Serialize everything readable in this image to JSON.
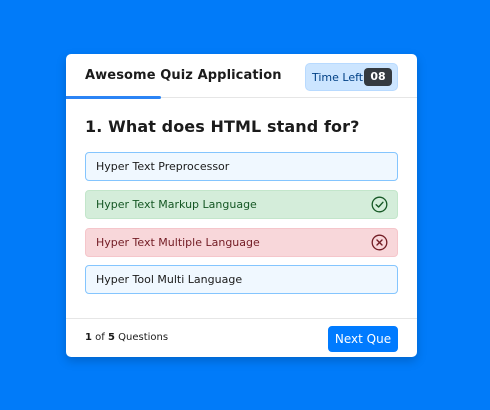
{
  "colors": {
    "page_background": "#017bf9",
    "accent": "#2b84f5",
    "correct": "#155724",
    "incorrect": "#721c24"
  },
  "header": {
    "title": "Awesome Quiz Application",
    "timer_label": "Time Left",
    "timer_seconds": "08"
  },
  "question": {
    "title": "1. What does HTML stand for?"
  },
  "options": [
    {
      "text": "Hyper Text Preprocessor",
      "state": "neutral",
      "icon": ""
    },
    {
      "text": "Hyper Text Markup Language",
      "state": "correct",
      "icon": "check-circle-icon"
    },
    {
      "text": "Hyper Text Multiple Language",
      "state": "incorrect",
      "icon": "x-circle-icon"
    },
    {
      "text": "Hyper Tool Multi Language",
      "state": "neutral",
      "icon": ""
    }
  ],
  "footer": {
    "current": "1",
    "of_word": "of",
    "total": "5",
    "questions_word": "Questions",
    "next_label": "Next Que"
  }
}
